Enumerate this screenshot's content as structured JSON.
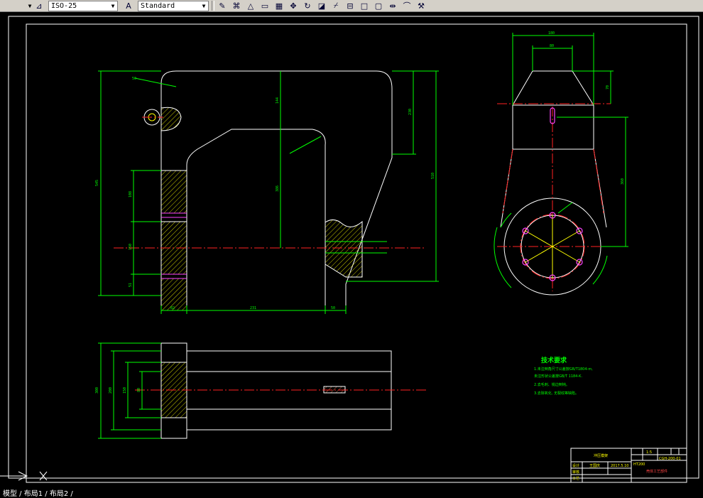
{
  "toolbar": {
    "dimstyle_value": "ISO-25",
    "textstyle_value": "Standard",
    "icons": [
      "pencil-icon",
      "lasso-icon",
      "triangle-icon",
      "stamp-icon",
      "grid-icon",
      "move-icon",
      "rotate-icon",
      "scale-icon",
      "trim-icon",
      "mirror-icon",
      "rect-icon",
      "explode-icon",
      "arc-icon",
      "paint-icon"
    ]
  },
  "drawing": {
    "tech_req_title": "技术要求",
    "tech_req_lines": [
      "1.未注倒角尺寸公差按GB/T1804-m,",
      "  未注形状公差按GB/T 1184-K.",
      "2.去毛刺、锐边倒钝。",
      "3.去除氧化, 无裂纹等缺陷。"
    ],
    "title_block": {
      "part_name": "冲压模架",
      "scale": "1:5",
      "drawing_no": "CGH-200-01",
      "material": "HT200",
      "company": "壳体工艺部件",
      "designer": "王国庆",
      "date": "2017.5.10",
      "row_labels": [
        "设计",
        "审核",
        "工艺"
      ]
    },
    "dims": {
      "top_h": "50",
      "total_h": "545",
      "d1": "108",
      "d2": "150",
      "d3": "51",
      "h_inner": "386",
      "h_right": "510",
      "h_top": "144",
      "h_r2": "230",
      "w1": "82",
      "w2": "231",
      "w3": "50",
      "side_top": "180",
      "side_inner": "80",
      "side_h": "70",
      "side_h2": "360",
      "plan_h1": "300",
      "plan_h2": "200",
      "plan_h3": "150",
      "plan_h4": "80"
    }
  },
  "status": {
    "tabs_text": "模型 / 布局1 / 布局2 /"
  }
}
